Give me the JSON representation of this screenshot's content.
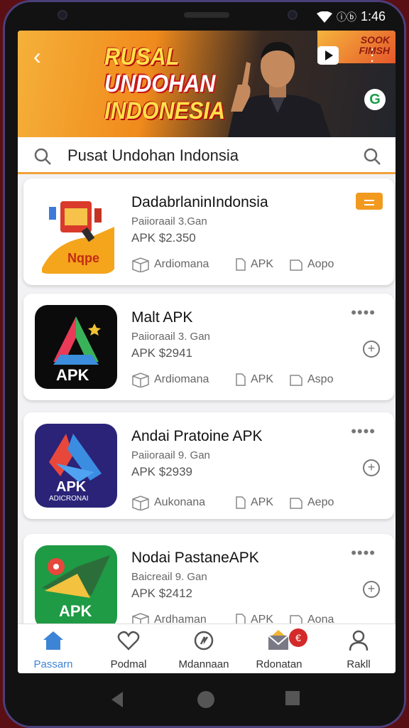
{
  "status": {
    "time": "1:46",
    "signal_icon": "wifi-icon",
    "battery_glyph": "ⓘⓑ"
  },
  "banner": {
    "title_line1": "RUSAL",
    "title_line2": "UNDOHAN",
    "title_line3": "INDONESIA",
    "sticker_line1": "SOOK",
    "sticker_line2": "FIMSH",
    "badge": "G"
  },
  "search": {
    "value": "Pusat Undohan Indonsia"
  },
  "apps": [
    {
      "name": "DadabrlaninIndonsia",
      "sub": "Paiioraail 3.Gan",
      "price": "APK  $2.350",
      "tag1": "Ardiomana",
      "tag2": "APK",
      "tag3": "Aopo",
      "icon_text": "Nqpe"
    },
    {
      "name": "Malt APK",
      "sub": "Paiioraail 3. Gan",
      "price": "APK  $2941",
      "tag1": "Ardiomana",
      "tag2": "APK",
      "tag3": "Aspo",
      "icon_text": "APK"
    },
    {
      "name": "Andai Pratoine APK",
      "sub": "Paiioraail 9. Gan",
      "price": "APK  $2939",
      "tag1": "Aukonana",
      "tag2": "APK",
      "tag3": "Aepo",
      "icon_text": "APK",
      "icon_sub": "ADICRONAI"
    },
    {
      "name": "Nodai PastaneAPK",
      "sub": "Baicreail 9. Gan",
      "price": "APK  $2412",
      "tag1": "Ardhaman",
      "tag2": "APK",
      "tag3": "Aona",
      "icon_text": "APK"
    }
  ],
  "nav": [
    {
      "label": "Passarn",
      "icon": "home-icon"
    },
    {
      "label": "Podmal",
      "icon": "heart-icon"
    },
    {
      "label": "Mdannaan",
      "icon": "no-signal-icon"
    },
    {
      "label": "Rdonatan",
      "icon": "mail-icon",
      "badge": "€"
    },
    {
      "label": "Rakll",
      "icon": "user-icon"
    }
  ],
  "colors": {
    "accent": "#f29a1f",
    "nav_active": "#3e84d6"
  }
}
